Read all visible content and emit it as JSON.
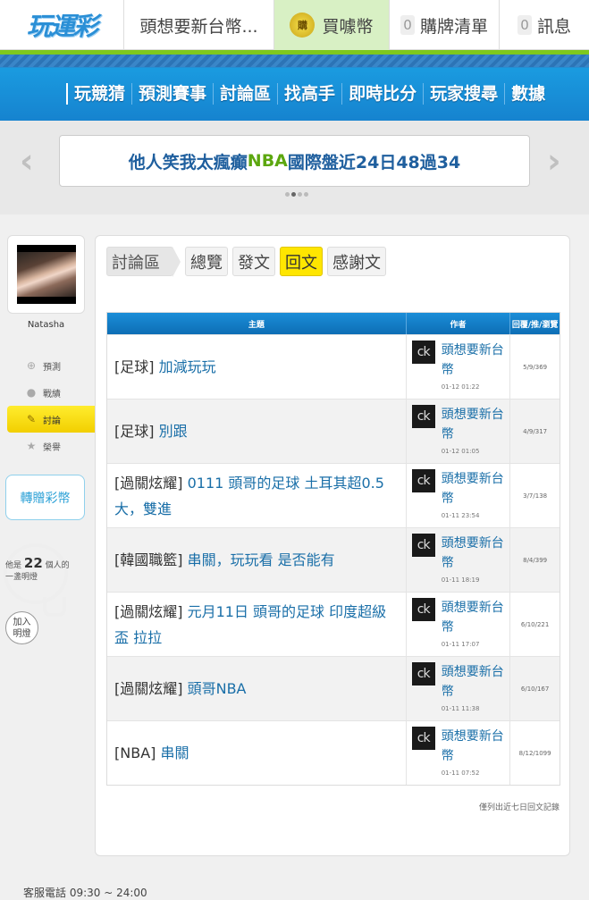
{
  "topbar": {
    "logo": "玩運彩",
    "title": "頭想要新台幣...",
    "coin_badge": "購",
    "coin_label": "買噱幣",
    "cart_count": "0",
    "cart_label": "購牌清單",
    "msg_count": "0",
    "msg_label": "訊息"
  },
  "nav": {
    "items": [
      "玩競猜",
      "預測賽事",
      "討論區",
      "找高手",
      "即時比分",
      "玩家搜尋",
      "數據"
    ]
  },
  "banner": {
    "text_before": "他人笑我太瘋癲",
    "text_green": " NBA ",
    "text_after": "國際盤近24日48過34",
    "left_arrow": "‹",
    "right_arrow": "›"
  },
  "sidebar": {
    "username": "Natasha",
    "items": [
      {
        "label": "預測",
        "icon": "⊕"
      },
      {
        "label": "戰績",
        "icon": "●"
      },
      {
        "label": "討論",
        "icon": "✎"
      },
      {
        "label": "榮譽",
        "icon": "★"
      }
    ],
    "transfer_label": "轉贈彩幣",
    "bulb_prefix": "他是",
    "bulb_count": "22",
    "bulb_mid": "個人的",
    "bulb_suffix": "一盞明燈",
    "join_line1": "加入",
    "join_line2": "明燈"
  },
  "main": {
    "tabs": [
      "討論區",
      "總覽",
      "發文",
      "回文",
      "感謝文"
    ],
    "headers": {
      "topic": "主題",
      "author": "作者",
      "stats": "回覆/推/瀏覽"
    },
    "rows": [
      {
        "category": "[足球]",
        "title": "加減玩玩",
        "author": "頭想要新台幣",
        "time": "01-12 01:22",
        "stats": "5/9/369"
      },
      {
        "category": "[足球]",
        "title": "別跟",
        "author": "頭想要新台幣",
        "time": "01-12 01:05",
        "stats": "4/9/317"
      },
      {
        "category": "[過關炫耀]",
        "title": "0111 頭哥的足球 土耳其超0.5大，雙進",
        "author": "頭想要新台幣",
        "time": "01-11 23:54",
        "stats": "3/7/138"
      },
      {
        "category": "[韓國職籃]",
        "title": "串關，玩玩看 是否能有",
        "author": "頭想要新台幣",
        "time": "01-11 18:19",
        "stats": "8/4/399"
      },
      {
        "category": "[過關炫耀]",
        "title": "元月11日 頭哥的足球 印度超級盃 拉拉",
        "author": "頭想要新台幣",
        "time": "01-11 17:07",
        "stats": "6/10/221"
      },
      {
        "category": "[過關炫耀]",
        "title": "頭哥NBA",
        "author": "頭想要新台幣",
        "time": "01-11 11:38",
        "stats": "6/10/167"
      },
      {
        "category": "[NBA]",
        "title": "串關",
        "author": "頭想要新台幣",
        "time": "01-11 07:52",
        "stats": "8/12/1099"
      }
    ],
    "avatar_text": "ck",
    "note": "僅列出近七日回文記錄"
  },
  "footer": {
    "text": "客服電話 09:30 ~ 24:00"
  }
}
